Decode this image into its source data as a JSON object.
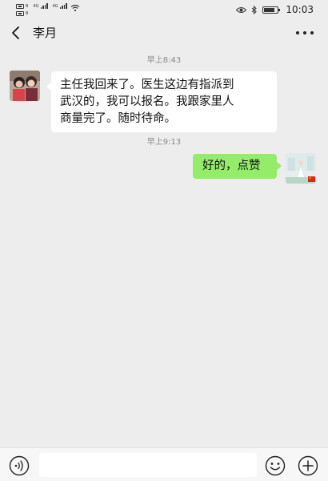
{
  "status_bar": {
    "sim1": "B",
    "sim2": "B",
    "network1": "4G",
    "network2": "4G",
    "time": "10:03",
    "battery_level": 0.8,
    "icons": [
      "sim-icon",
      "signal-icon",
      "wifi-icon",
      "eye-icon",
      "bluetooth-icon",
      "battery-icon"
    ]
  },
  "header": {
    "title": "李月",
    "back_icon": "chevron-left-icon",
    "more_icon": "more-dots-icon"
  },
  "messages": [
    {
      "timestamp": "早上8:43",
      "direction": "incoming",
      "line1": "主任我回来了。医生这边有指派到",
      "line2": "武汉的，我可以报名。我跟家里人",
      "line3": "商量完了。随时待命。"
    },
    {
      "timestamp": "早上9:13",
      "direction": "outgoing",
      "text": "好的，点赞"
    }
  ],
  "input_bar": {
    "placeholder": "",
    "value": "",
    "voice_icon": "voice-icon",
    "emoji_icon": "emoji-icon",
    "plus_icon": "plus-icon"
  },
  "colors": {
    "background": "#ededed",
    "incoming_bubble": "#ffffff",
    "outgoing_bubble": "#95ec69",
    "timestamp_text": "#888888"
  }
}
